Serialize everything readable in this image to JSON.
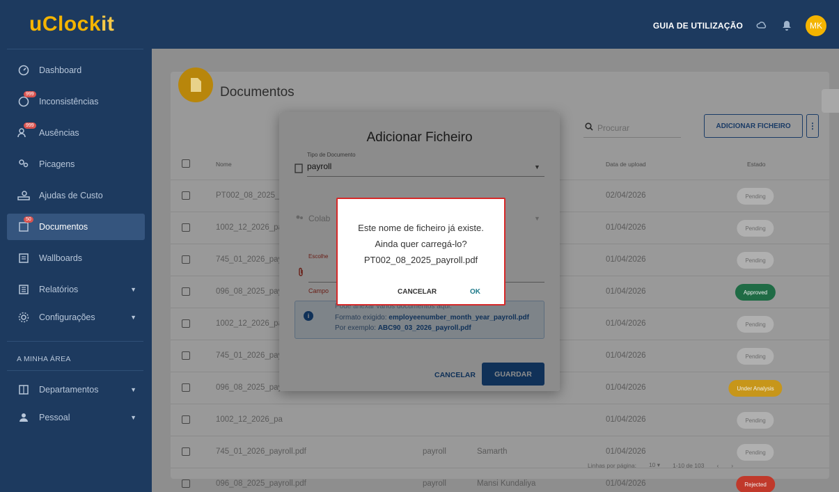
{
  "app": {
    "logo": "uClockit",
    "guide": "GUIA DE UTILIZAÇÃO",
    "avatar": "MK"
  },
  "sidebar": {
    "items": [
      {
        "label": "Dashboard",
        "icon": "dashboard-icon"
      },
      {
        "label": "Inconsistências",
        "icon": "clock-alert-icon",
        "badge": "999"
      },
      {
        "label": "Ausências",
        "icon": "people-away-icon",
        "badge": "999"
      },
      {
        "label": "Picagens",
        "icon": "people-icon"
      },
      {
        "label": "Ajudas de Custo",
        "icon": "person-money-icon"
      },
      {
        "label": "Documentos",
        "icon": "document-icon",
        "badge": "50"
      },
      {
        "label": "Wallboards",
        "icon": "wallboard-icon"
      },
      {
        "label": "Relatórios",
        "icon": "report-icon"
      },
      {
        "label": "Configurações",
        "icon": "settings-icon"
      },
      {
        "label": "Departamentos",
        "icon": "building-icon"
      },
      {
        "label": "Pessoal",
        "icon": "person-icon"
      }
    ],
    "section": "A MINHA ÁREA"
  },
  "page": {
    "title": "Documentos",
    "search_placeholder": "Procurar",
    "add_button": "ADICIONAR FICHEIRO",
    "columns": {
      "name": "Nome",
      "date": "Data de upload",
      "status": "Estado"
    },
    "rows": [
      {
        "name": "PT002_08_2025_p",
        "type": "",
        "collab": "",
        "date": "02/04/2026",
        "status": "Pending"
      },
      {
        "name": "1002_12_2026_pa",
        "type": "",
        "collab": "",
        "date": "01/04/2026",
        "status": "Pending"
      },
      {
        "name": "745_01_2026_payr",
        "type": "",
        "collab": "",
        "date": "01/04/2026",
        "status": "Pending"
      },
      {
        "name": "096_08_2025_payr",
        "type": "",
        "collab": "",
        "date": "01/04/2026",
        "status": "Approved"
      },
      {
        "name": "1002_12_2026_pa",
        "type": "",
        "collab": "",
        "date": "01/04/2026",
        "status": "Pending"
      },
      {
        "name": "745_01_2026_payr",
        "type": "",
        "collab": "",
        "date": "01/04/2026",
        "status": "Pending"
      },
      {
        "name": "096_08_2025_payr",
        "type": "",
        "collab": "",
        "date": "01/04/2026",
        "status": "Under Analysis"
      },
      {
        "name": "1002_12_2026_pa",
        "type": "",
        "collab": "",
        "date": "01/04/2026",
        "status": "Pending"
      },
      {
        "name": "745_01_2026_payroll.pdf",
        "type": "payroll",
        "collab": "Samarth",
        "date": "01/04/2026",
        "status": "Pending"
      },
      {
        "name": "096_08_2025_payroll.pdf",
        "type": "payroll",
        "collab": "Mansi Kundaliya",
        "date": "01/04/2026",
        "status": "Rejected"
      }
    ],
    "pager": {
      "rows_label": "Linhas por página:",
      "rows_value": "10",
      "range": "1-10 de 103"
    }
  },
  "status_colors": {
    "Pending": "#b0b0b0",
    "Approved": "#1f6b45",
    "Under Analysis": "#c7961a",
    "Rejected": "#c0392b"
  },
  "modal": {
    "title": "Adicionar Ficheiro",
    "doc_type_label": "Tipo de Documento",
    "doc_type_value": "payroll",
    "collab_label": "Colab",
    "file_label": "Escolhe",
    "required": "Campo",
    "info_l1": "Pode anexar vários documentos aqui.",
    "info_l2_prefix": "Formato exigido:",
    "info_l2_value": "employeenumber_month_year_payroll.pdf",
    "info_l3_prefix": "Por exemplo:",
    "info_l3_value": "ABC90_03_2026_payroll.pdf",
    "cancel": "CANCELAR",
    "save": "GUARDAR"
  },
  "confirm": {
    "line1": "Este nome de ficheiro já existe.",
    "line2": "Ainda quer carregá-lo?",
    "line3": "PT002_08_2025_payroll.pdf",
    "cancel": "CANCELAR",
    "ok": "OK"
  }
}
